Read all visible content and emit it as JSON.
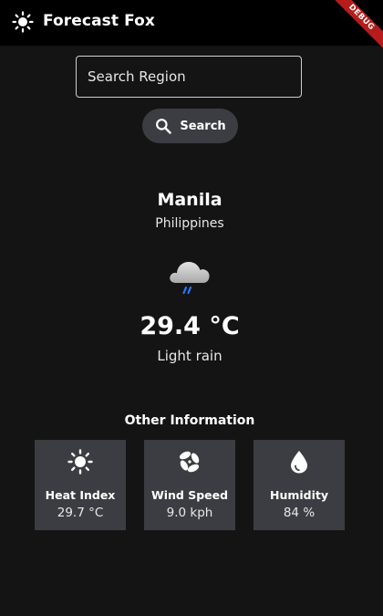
{
  "app": {
    "title": "Forecast Fox",
    "debug_label": "DEBUG",
    "logo_icon": "sun-icon"
  },
  "search": {
    "placeholder": "Search Region",
    "value": "",
    "button_label": "Search",
    "button_icon": "search-icon"
  },
  "location": {
    "city": "Manila",
    "country": "Philippines"
  },
  "current": {
    "icon": "rain-cloud-icon",
    "temperature": "29.4 °C",
    "condition": "Light rain"
  },
  "other_info": {
    "title": "Other Information",
    "cards": [
      {
        "icon": "sun-icon",
        "title": "Heat Index",
        "value": "29.7 °C"
      },
      {
        "icon": "fan-icon",
        "title": "Wind Speed",
        "value": "9.0 kph"
      },
      {
        "icon": "water-drop-icon",
        "title": "Humidity",
        "value": "84 %"
      }
    ]
  },
  "colors": {
    "background": "#141414",
    "appbar": "#000000",
    "card": "#3b3d42",
    "rain_accent": "#2979ff",
    "debug_ribbon": "#b71c1c"
  }
}
